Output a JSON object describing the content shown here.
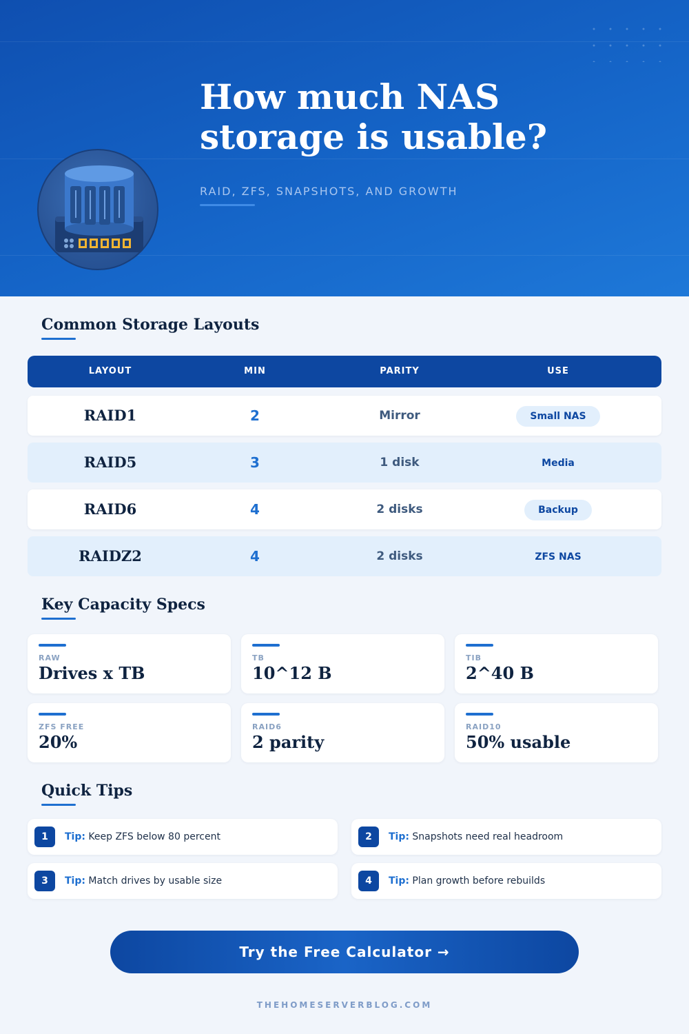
{
  "hero": {
    "title": "How much NAS\nstorage is usable?",
    "subtitle": "RAID, ZFS, SNAPSHOTS, AND GROWTH",
    "icon": "nas-drive-icon"
  },
  "layouts": {
    "heading": "Common Storage Layouts",
    "columns": [
      "LAYOUT",
      "MIN",
      "PARITY",
      "USE"
    ],
    "rows": [
      {
        "layout": "RAID1",
        "min": "2",
        "parity": "Mirror",
        "use": "Small NAS"
      },
      {
        "layout": "RAID5",
        "min": "3",
        "parity": "1 disk",
        "use": "Media"
      },
      {
        "layout": "RAID6",
        "min": "4",
        "parity": "2 disks",
        "use": "Backup"
      },
      {
        "layout": "RAIDZ2",
        "min": "4",
        "parity": "2 disks",
        "use": "ZFS NAS"
      }
    ]
  },
  "specs": {
    "heading": "Key Capacity Specs",
    "cards": [
      {
        "label": "RAW",
        "value": "Drives x TB"
      },
      {
        "label": "TB",
        "value": "10^12 B"
      },
      {
        "label": "TIB",
        "value": "2^40 B"
      },
      {
        "label": "ZFS FREE",
        "value": "20%"
      },
      {
        "label": "RAID6",
        "value": "2 parity"
      },
      {
        "label": "RAID10",
        "value": "50% usable"
      }
    ]
  },
  "tips": {
    "heading": "Quick Tips",
    "prefix": "Tip:",
    "items": [
      {
        "num": "1",
        "text": "Keep ZFS below 80 percent"
      },
      {
        "num": "2",
        "text": "Snapshots need real headroom"
      },
      {
        "num": "3",
        "text": "Match drives by usable size"
      },
      {
        "num": "4",
        "text": "Plan growth before rebuilds"
      }
    ]
  },
  "cta": {
    "label": "Try the Free Calculator →"
  },
  "footer": {
    "site": "THEHOMESERVERBLOG.COM"
  },
  "colors": {
    "primary": "#0d47a1",
    "accent": "#1e6fd0",
    "light": "#e2effc",
    "background": "#f1f5fb"
  }
}
